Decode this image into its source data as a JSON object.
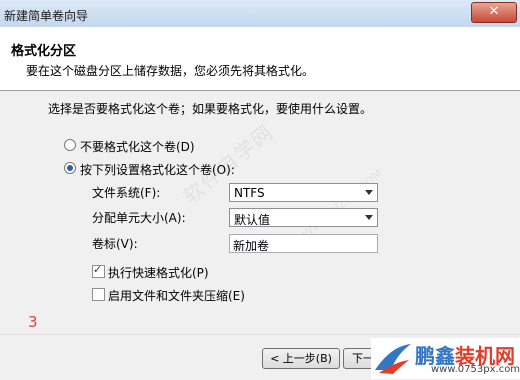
{
  "window": {
    "title": "新建简单卷向导",
    "close_glyph": "✕"
  },
  "header": {
    "title": "格式化分区",
    "subtitle": "要在这个磁盘分区上储存数据，您必须先将其格式化。"
  },
  "main": {
    "prompt": "选择是否要格式化这个卷；如果要格式化，要使用什么设置。",
    "option_no_format": {
      "label": "不要格式化这个卷(D)",
      "selected": false
    },
    "option_format": {
      "label": "按下列设置格式化这个卷(O):",
      "selected": true
    },
    "file_system": {
      "label": "文件系统(F):",
      "value": "NTFS"
    },
    "allocation_unit": {
      "label": "分配单元大小(A):",
      "value": "默认值"
    },
    "volume_label": {
      "label": "卷标(V):",
      "value": "新加卷"
    },
    "quick_format": {
      "label": "执行快速格式化(P)",
      "checked": true
    },
    "compression": {
      "label": "启用文件和文件夹压缩(E)",
      "checked": false
    },
    "step_marker": "3",
    "watermark_text": "软件自学网",
    "watermark_url": "WWW.RJZXW.COM"
  },
  "footer": {
    "back_label": "< 上一步(B)",
    "next_label": "下一"
  },
  "logo": {
    "name_part1": "鹏鑫",
    "name_part2": "装机网",
    "url": "www.0753px.com"
  },
  "colors": {
    "accent": "#2e5ea8",
    "marker": "#e0433a",
    "logo_blue": "#3476c4",
    "logo_red": "#e23c2a"
  }
}
